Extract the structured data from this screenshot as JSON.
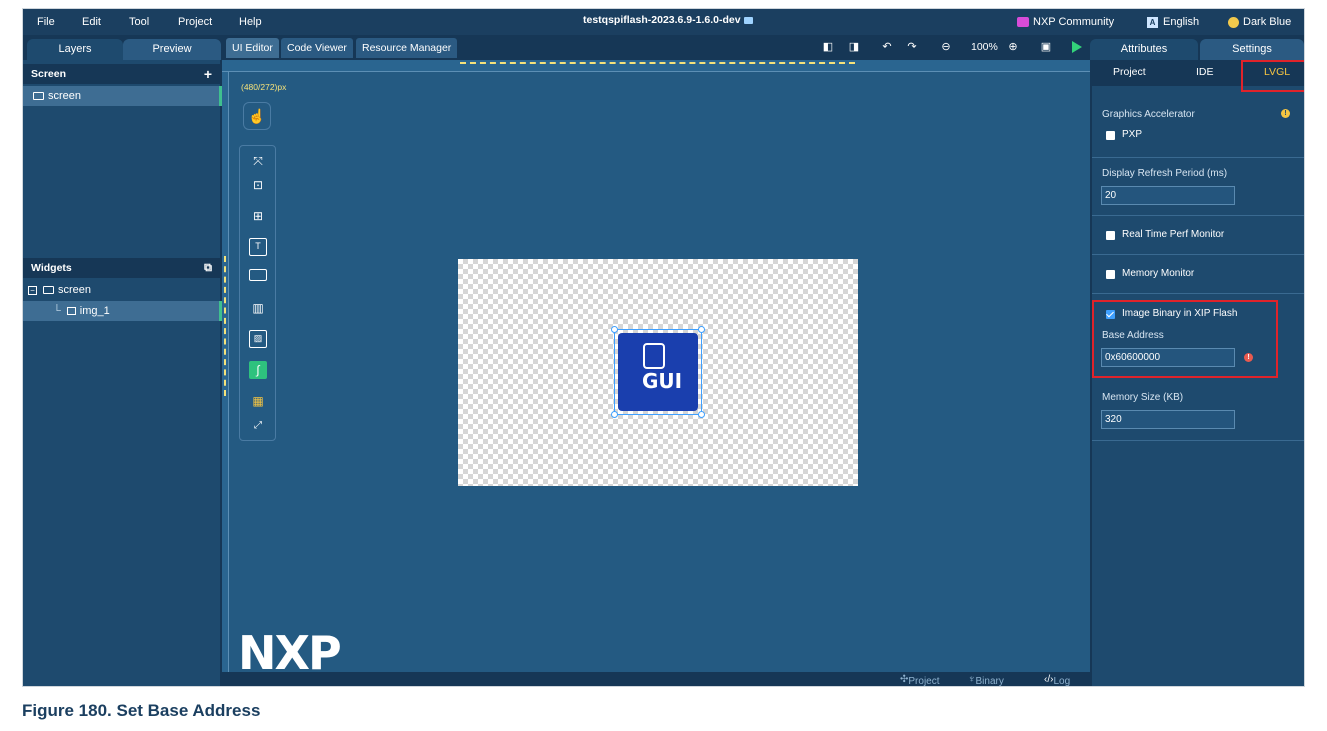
{
  "menu": {
    "items": [
      "File",
      "Edit",
      "Tool",
      "Project",
      "Help"
    ]
  },
  "window_title": "testqspiflash-2023.6.9-1.6.0-dev",
  "top_right": {
    "community": "NXP Community",
    "language": "English",
    "theme": "Dark Blue"
  },
  "left_tabs": {
    "layers": "Layers",
    "preview": "Preview"
  },
  "editor_tabs": {
    "ui_editor": "UI Editor",
    "code_viewer": "Code Viewer",
    "resource_manager": "Resource Manager"
  },
  "toolbar": {
    "zoom": "100%"
  },
  "right_tabs": {
    "attributes": "Attributes",
    "settings": "Settings"
  },
  "screen_panel": {
    "title": "Screen",
    "add": "+",
    "items": [
      {
        "label": "screen"
      }
    ]
  },
  "widgets_panel": {
    "title": "Widgets",
    "tree": [
      {
        "label": "screen"
      },
      {
        "label": "img_1"
      }
    ]
  },
  "editor": {
    "dimension": "(480/272)px",
    "logo": "NXP",
    "image_text": "GUI"
  },
  "bottom_bar": {
    "project": "Project",
    "binary_size": "Binary Size",
    "log": "Log"
  },
  "settings": {
    "subtabs": {
      "project": "Project",
      "ide": "IDE",
      "lvgl": "LVGL",
      "active": "LVGL"
    },
    "graphics_accelerator": {
      "label": "Graphics Accelerator",
      "pxp_label": "PXP",
      "pxp_checked": false
    },
    "display_refresh": {
      "label": "Display Refresh Period  (ms)",
      "value": "20"
    },
    "real_time_perf": {
      "label": "Real Time Perf Monitor",
      "checked": false
    },
    "memory_monitor": {
      "label": "Memory Monitor",
      "checked": false
    },
    "image_binary_xip": {
      "label": "Image Binary in XIP Flash",
      "checked": true
    },
    "base_address": {
      "label": "Base Address",
      "value": "0x60600000"
    },
    "memory_size": {
      "label": "Memory Size (KB)",
      "value": "320"
    }
  },
  "caption": "Figure 180.  Set Base Address",
  "colors": {
    "frame_bg": "#1e4a6e",
    "highlight": "#e0232a",
    "accent_green": "#2ec27e"
  }
}
